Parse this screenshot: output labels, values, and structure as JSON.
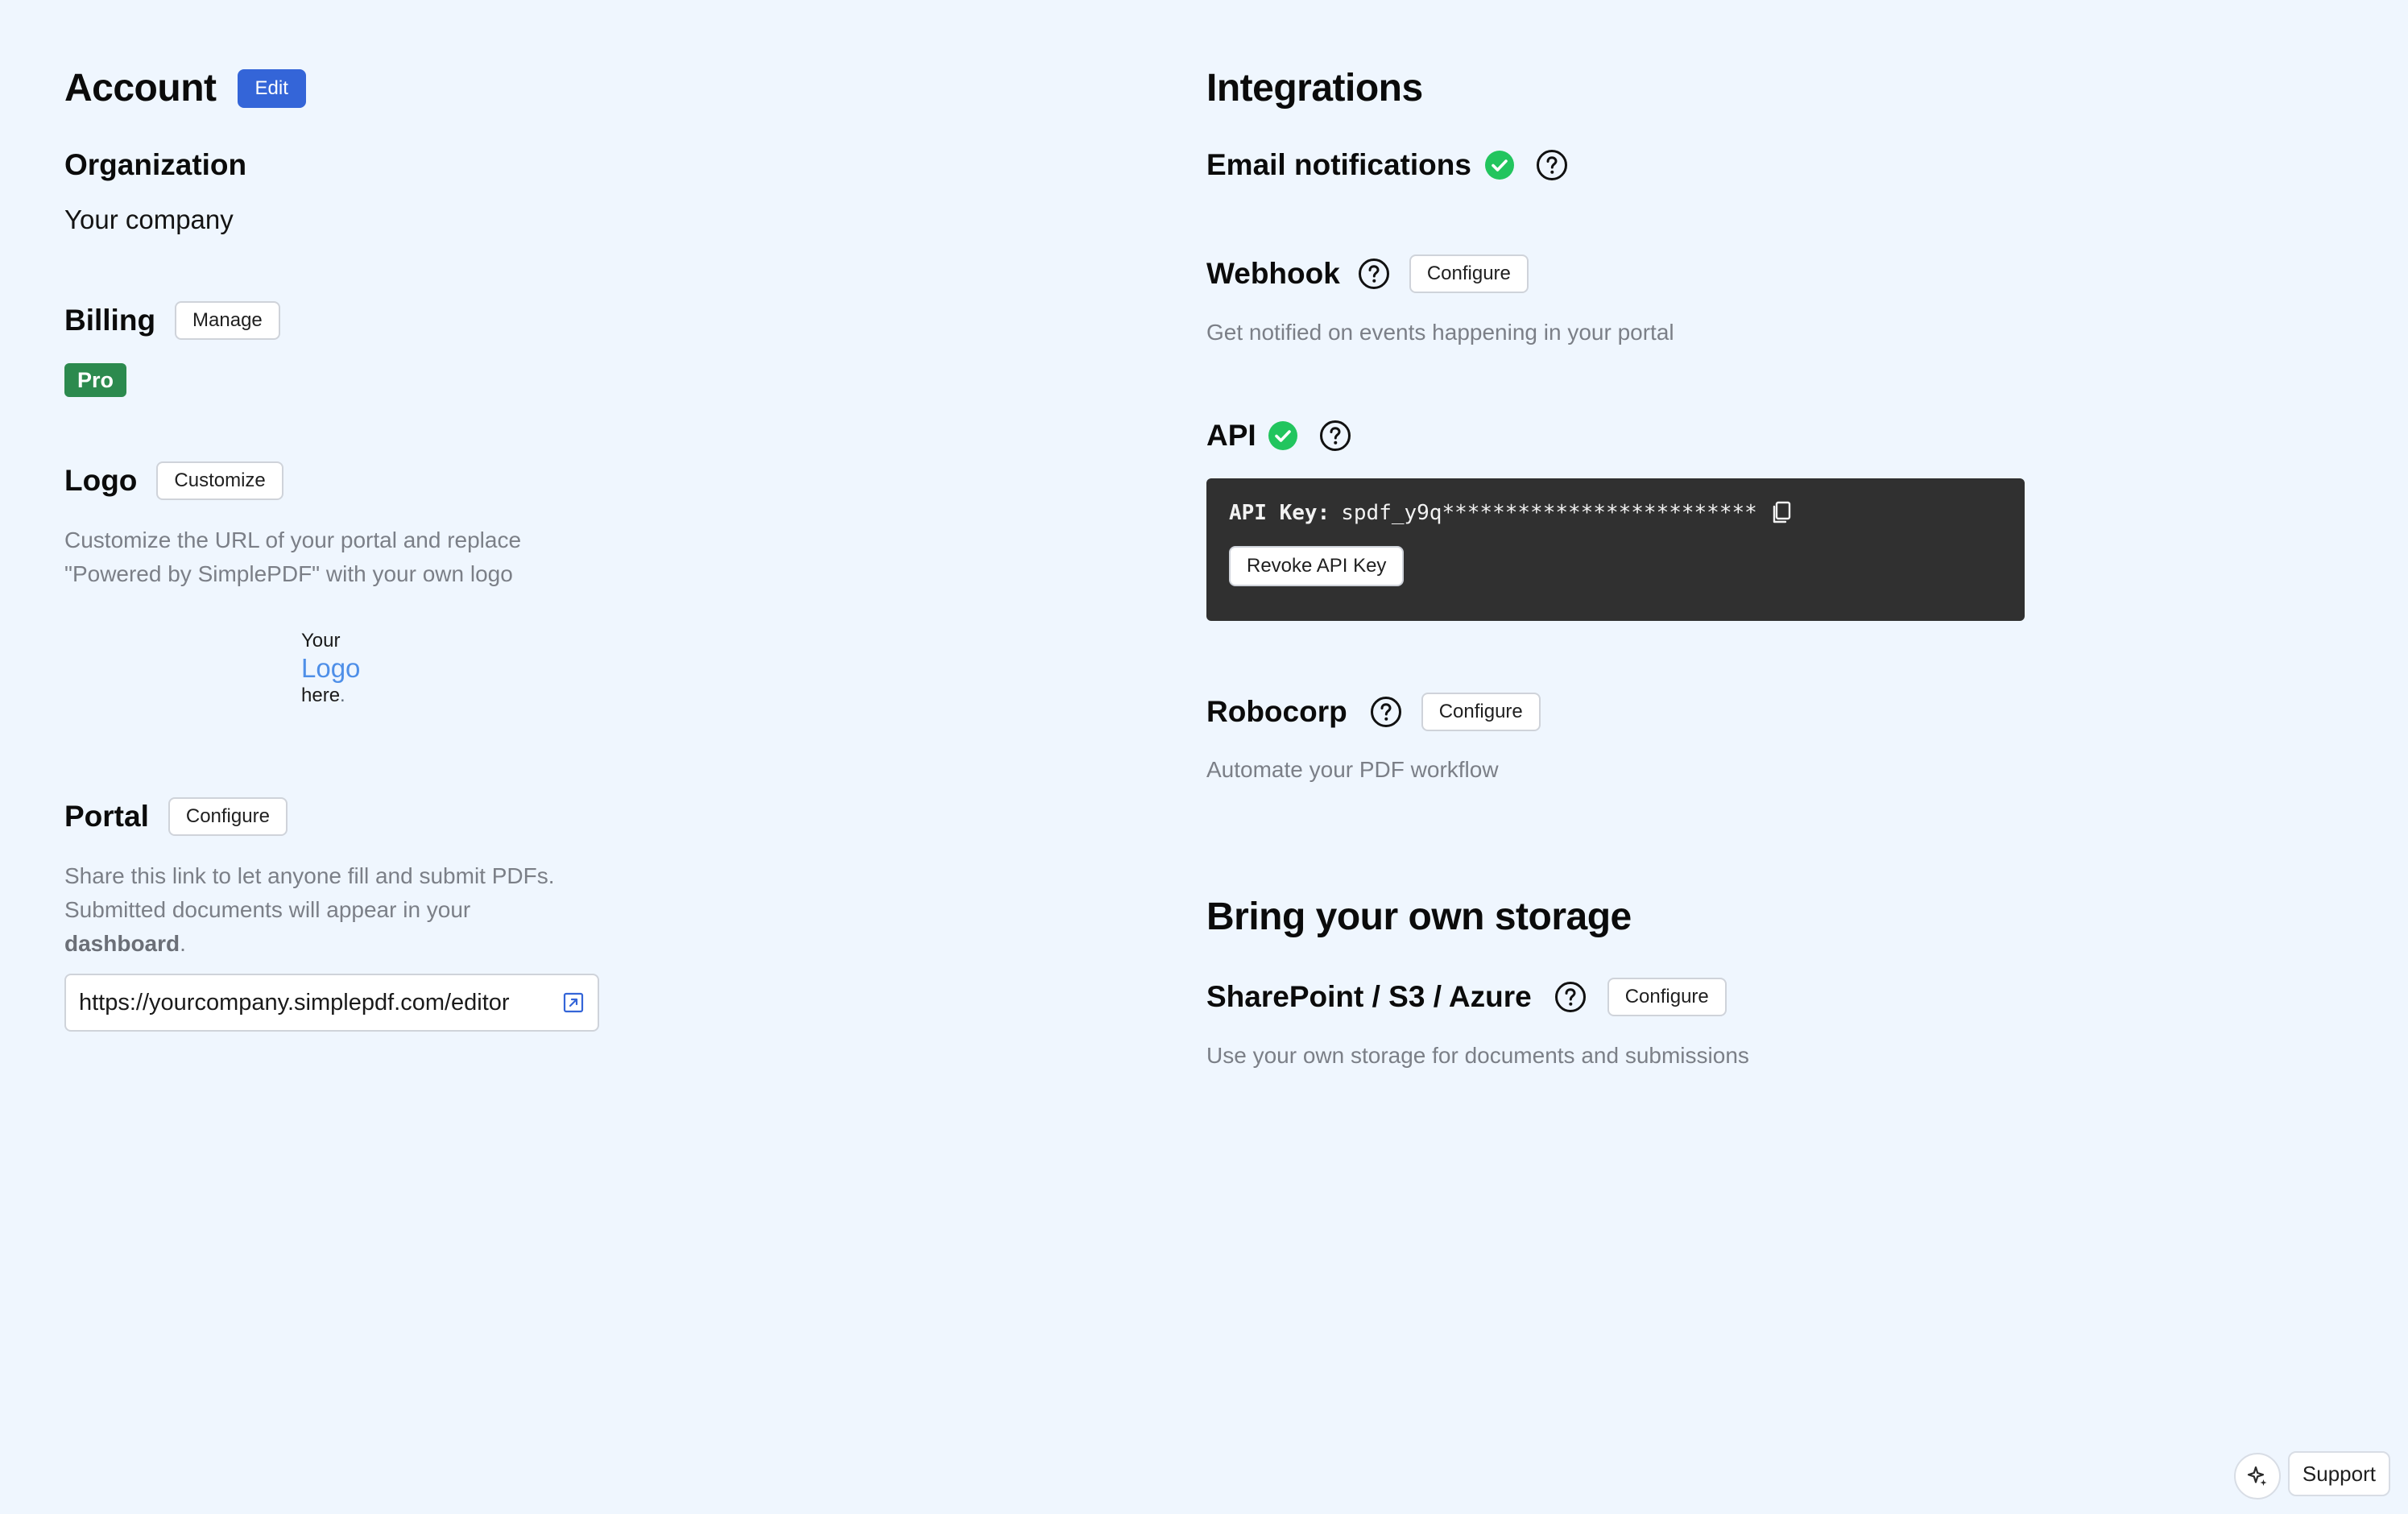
{
  "account": {
    "title": "Account",
    "edit_label": "Edit",
    "organization": {
      "heading": "Organization",
      "value": "Your company"
    },
    "billing": {
      "heading": "Billing",
      "manage_label": "Manage",
      "plan_badge": "Pro"
    },
    "logo": {
      "heading": "Logo",
      "customize_label": "Customize",
      "description_line1": "Customize the URL of your portal and replace",
      "description_line2": "\"Powered by SimplePDF\" with your own logo",
      "placeholder_line1": "Your",
      "placeholder_line2": "Logo",
      "placeholder_line3": "here",
      "placeholder_dot": "."
    },
    "portal": {
      "heading": "Portal",
      "configure_label": "Configure",
      "description_line1": "Share this link to let anyone fill and submit PDFs.",
      "description_line2": "Submitted documents will appear in your",
      "description_link": "dashboard",
      "description_end": ".",
      "url": "https://yourcompany.simplepdf.com/editor"
    }
  },
  "integrations": {
    "title": "Integrations",
    "email": {
      "heading": "Email notifications"
    },
    "webhook": {
      "heading": "Webhook",
      "configure_label": "Configure",
      "description": "Get notified on events happening in your portal"
    },
    "api": {
      "heading": "API",
      "key_label": "API Key:",
      "key_value": "spdf_y9q*************************",
      "revoke_label": "Revoke API Key"
    },
    "robocorp": {
      "heading": "Robocorp",
      "configure_label": "Configure",
      "description": "Automate your PDF workflow"
    }
  },
  "storage": {
    "title": "Bring your own storage",
    "provider": {
      "heading": "SharePoint / S3 / Azure",
      "configure_label": "Configure",
      "description": "Use your own storage for documents and submissions"
    }
  },
  "support": {
    "label": "Support"
  },
  "icons": {
    "help": "help-circle-icon",
    "check": "check-circle-icon",
    "copy": "copy-icon",
    "external_link": "external-link-icon",
    "sparkle": "sparkle-icon"
  },
  "colors": {
    "background": "#eff6fe",
    "primary": "#3465d8",
    "success": "#22c55e",
    "badge_green": "#2c8a4e",
    "api_panel": "#303030",
    "logo_blue": "#4e8fe8"
  }
}
